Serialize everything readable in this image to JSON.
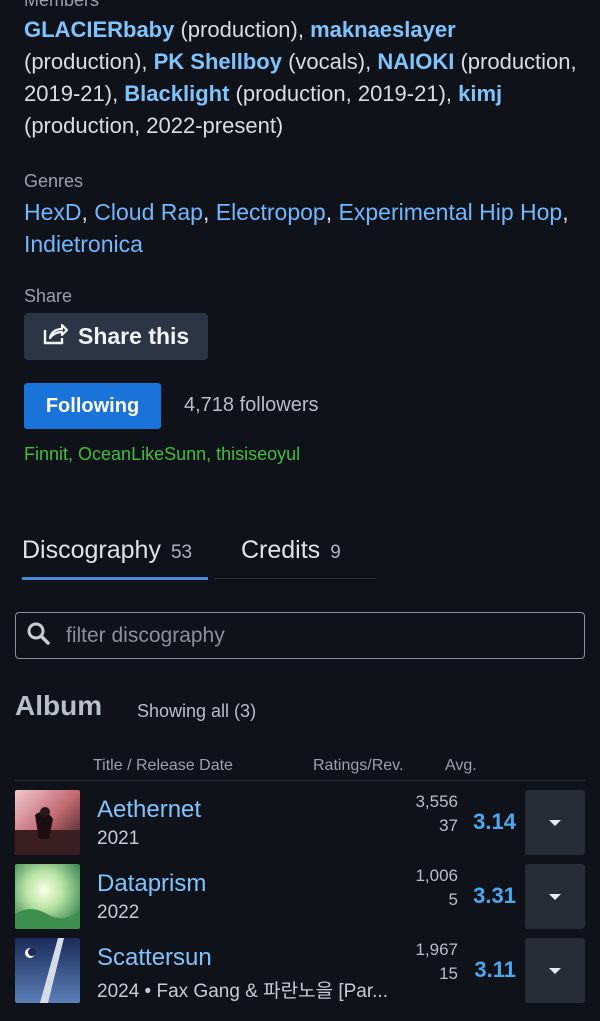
{
  "members_label": "Members",
  "members": {
    "m1": "GLACIERbaby",
    "r1": " (production), ",
    "m2": "maknaeslayer",
    "r2": " (production), ",
    "m3": "PK Shellboy",
    "r3": " (vocals), ",
    "m4": "NAIOKI",
    "r4": " (production, 2019-21), ",
    "m5": "Blacklight",
    "r5": " (production, 2019-21), ",
    "m6": "kimj",
    "r6": " (production, 2022-present)"
  },
  "genres_label": "Genres",
  "genres": [
    "HexD",
    "Cloud Rap",
    "Electropop",
    "Experimental Hip Hop",
    "Indietronica"
  ],
  "share_label": "Share",
  "share_button": "Share this",
  "follow_button": "Following",
  "followers": "4,718 followers",
  "friends": [
    "Finnit",
    "OceanLikeSunn",
    "thisiseoyul"
  ],
  "tabs": [
    {
      "label": "Discography",
      "count": "53"
    },
    {
      "label": "Credits",
      "count": "9"
    }
  ],
  "filter": {
    "placeholder": "filter discography"
  },
  "section": {
    "title": "Album",
    "showing": "Showing all (3)"
  },
  "columns": {
    "title": "Title",
    "sep": "/",
    "release": "Release Date",
    "ratings": "Ratings/Rev.",
    "avg": "Avg."
  },
  "albums": [
    {
      "title": "Aethernet",
      "sub": "2021",
      "ratings": "3,556",
      "reviews": "37",
      "avg": "3.14"
    },
    {
      "title": "Dataprism",
      "sub": "2022",
      "ratings": "1,006",
      "reviews": "5",
      "avg": "3.31"
    },
    {
      "title": "Scattersun",
      "sub": "2024 • Fax Gang & 파란노을 [Par...",
      "ratings": "1,967",
      "reviews": "15",
      "avg": "3.11"
    }
  ],
  "colors": {
    "link": "#7ec4ff",
    "accent": "#1a73d9",
    "friends": "#3fbf3f",
    "avg": "#4ca8ee"
  }
}
